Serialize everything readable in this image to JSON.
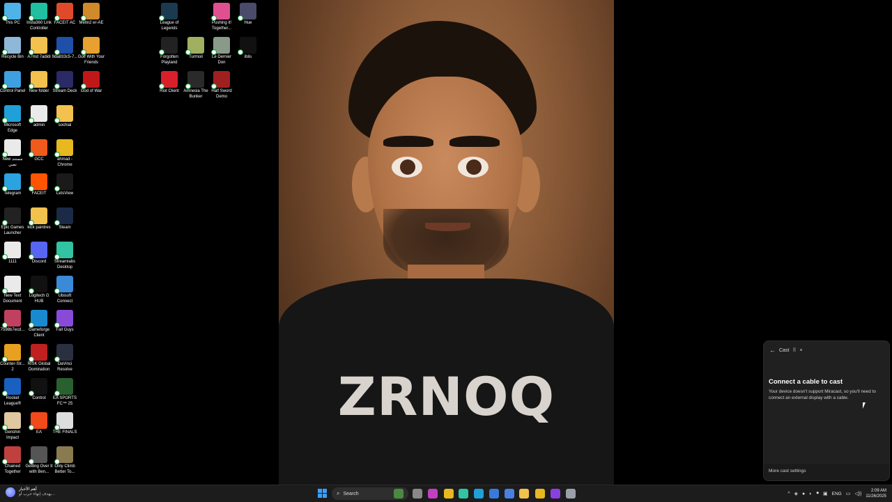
{
  "desktop": {
    "icons": [
      {
        "label": "This PC",
        "icon": "computer-icon",
        "color": "#4fb3e8"
      },
      {
        "label": "Insta360 Link Controller",
        "icon": "insta360-icon",
        "color": "#1fbfa0"
      },
      {
        "label": "FACEIT AC",
        "icon": "faceit-ac-icon",
        "color": "#e04a2a"
      },
      {
        "label": "Metin2 er-AE",
        "icon": "metin2-icon",
        "color": "#d08a2a"
      },
      {
        "label": "Recycle Bin",
        "icon": "recycle-bin-icon",
        "color": "#8fb8d8"
      },
      {
        "label": "A7md 7adidi",
        "icon": "folder-icon",
        "color": "#f2c14e"
      },
      {
        "label": "9da833c5-7...",
        "icon": "paypal-icon",
        "color": "#1f4fa8"
      },
      {
        "label": "Golf With Your Friends",
        "icon": "golf-icon",
        "color": "#e8a030"
      },
      {
        "label": "Control Panel",
        "icon": "control-panel-icon",
        "color": "#3ea0e0"
      },
      {
        "label": "New folder",
        "icon": "folder-icon",
        "color": "#f2c14e"
      },
      {
        "label": "Stream Deck",
        "icon": "stream-deck-icon",
        "color": "#2a2a66"
      },
      {
        "label": "God of War",
        "icon": "god-of-war-icon",
        "color": "#c01818"
      },
      {
        "label": "Microsoft Edge",
        "icon": "edge-icon",
        "color": "#1fa0d8"
      },
      {
        "label": "admin",
        "icon": "document-icon",
        "color": "#eaeaea"
      },
      {
        "label": "sochial",
        "icon": "folder-icon",
        "color": "#f2c14e"
      },
      {
        "label": "New مستند نصي",
        "icon": "document-icon",
        "color": "#eaeaea"
      },
      {
        "label": "GCC",
        "icon": "gcc-icon",
        "color": "#f05a1a"
      },
      {
        "label": "ahmad - Chrome",
        "icon": "chrome-icon",
        "color": "#e8b820"
      },
      {
        "label": "Telegram",
        "icon": "telegram-icon",
        "color": "#2aa3e0"
      },
      {
        "label": "FACEIT",
        "icon": "faceit-icon",
        "color": "#ff5500"
      },
      {
        "label": "LetsView",
        "icon": "letsview-icon",
        "color": "#1a1a1a"
      },
      {
        "label": "Epic Games Launcher",
        "icon": "epic-games-icon",
        "color": "#222222"
      },
      {
        "label": "kick paintres",
        "icon": "folder-icon",
        "color": "#f2c14e"
      },
      {
        "label": "Steam",
        "icon": "steam-icon",
        "color": "#1b2a46"
      },
      {
        "label": "1111",
        "icon": "document-icon",
        "color": "#eaeaea"
      },
      {
        "label": "Discord",
        "icon": "discord-icon",
        "color": "#5865f2"
      },
      {
        "label": "Streamlabs Desktop",
        "icon": "streamlabs-icon",
        "color": "#31c3a2"
      },
      {
        "label": "New Text Document",
        "icon": "document-icon",
        "color": "#eaeaea"
      },
      {
        "label": "Logitech G HUB",
        "icon": "logitech-icon",
        "color": "#111111"
      },
      {
        "label": "Ubisoft Connect",
        "icon": "ubisoft-icon",
        "color": "#3a8ad8"
      },
      {
        "label": "7598b7ecd...",
        "icon": "image-file-icon",
        "color": "#c04060"
      },
      {
        "label": "Gameforge Client",
        "icon": "gameforge-icon",
        "color": "#1a8ad0"
      },
      {
        "label": "Fall Guys",
        "icon": "fall-guys-icon",
        "color": "#8a4ad8"
      },
      {
        "label": "Counter-Str... 2",
        "icon": "counter-strike-icon",
        "color": "#e8a020"
      },
      {
        "label": "RISK Global Domination",
        "icon": "risk-icon",
        "color": "#c02020"
      },
      {
        "label": "DaVinci Resolve",
        "icon": "davinci-icon",
        "color": "#2a3040"
      },
      {
        "label": "Rocket League®",
        "icon": "rocket-league-icon",
        "color": "#1a60c0"
      },
      {
        "label": "Control",
        "icon": "control-game-icon",
        "color": "#111111"
      },
      {
        "label": "EA SPORTS FC™ 25",
        "icon": "ea-fc-icon",
        "color": "#2a6030"
      },
      {
        "label": "Genshin Impact",
        "icon": "genshin-icon",
        "color": "#e0c8a0"
      },
      {
        "label": "EA",
        "icon": "ea-icon",
        "color": "#f04a1a"
      },
      {
        "label": "THE FINALS",
        "icon": "the-finals-icon",
        "color": "#dddddd"
      },
      {
        "label": "Chained Together",
        "icon": "chained-together-icon",
        "color": "#c04040"
      },
      {
        "label": "Getting Over It with Ben...",
        "icon": "getting-over-it-icon",
        "color": "#555555"
      },
      {
        "label": "Only Climb Better To...",
        "icon": "only-climb-icon",
        "color": "#8a7a50"
      },
      {
        "label": "League of Legends",
        "icon": "league-of-legends-icon",
        "color": "#1a3a50"
      },
      {
        "label": "Pushing it! Together...",
        "icon": "pushing-it-icon",
        "color": "#e05090"
      },
      {
        "label": "Hue",
        "icon": "hue-icon",
        "color": "#4a4a6a"
      },
      {
        "label": "Forgotten Playland",
        "icon": "epic-games-icon",
        "color": "#222222"
      },
      {
        "label": "Turmoil",
        "icon": "turmoil-icon",
        "color": "#a0b060"
      },
      {
        "label": "Le Dernier Don",
        "icon": "le-dernier-don-icon",
        "color": "#8a9a8a"
      },
      {
        "label": "iblis",
        "icon": "iblis-icon",
        "color": "#111111"
      },
      {
        "label": "Riot Client",
        "icon": "riot-icon",
        "color": "#d8202a"
      },
      {
        "label": "Amnesia The Bunker",
        "icon": "amnesia-icon",
        "color": "#2a2a2a"
      },
      {
        "label": "Half Sword Demo",
        "icon": "half-sword-icon",
        "color": "#a02020"
      }
    ]
  },
  "wallpaper": {
    "shirt_text": "ZRNOQ"
  },
  "cast_panel": {
    "header_title": "Cast",
    "title": "Connect a cable to cast",
    "description": "Your device doesn't support Miracast, so you'll need to connect an external display with a cable.",
    "footer_link": "More cast settings"
  },
  "taskbar": {
    "news_title": "أهم الأخبار",
    "news_subtitle": "يهدف إنهاء حرب أو...",
    "search_placeholder": "Search",
    "apps": [
      {
        "icon": "widgets-icon",
        "color": "#4a8a40"
      },
      {
        "icon": "file-explorer-icon",
        "color": "#888888"
      },
      {
        "icon": "copilot-icon",
        "color": "#c040c0"
      },
      {
        "icon": "chrome-icon",
        "color": "#e8b820"
      },
      {
        "icon": "streamlabs-icon",
        "color": "#31c3a2"
      },
      {
        "icon": "edge-icon",
        "color": "#1fa0d8"
      },
      {
        "icon": "store-icon",
        "color": "#3a7ad8"
      },
      {
        "icon": "copilot-app-icon",
        "color": "#4a80e0"
      },
      {
        "icon": "folder-icon",
        "color": "#f2c14e"
      },
      {
        "icon": "chrome-icon",
        "color": "#e8b820"
      },
      {
        "icon": "messenger-icon",
        "color": "#8a40e0"
      },
      {
        "icon": "settings-icon",
        "color": "#9aa0aa"
      }
    ],
    "language": "ENG",
    "time": "2:09 AM",
    "date": "11/26/2025"
  }
}
